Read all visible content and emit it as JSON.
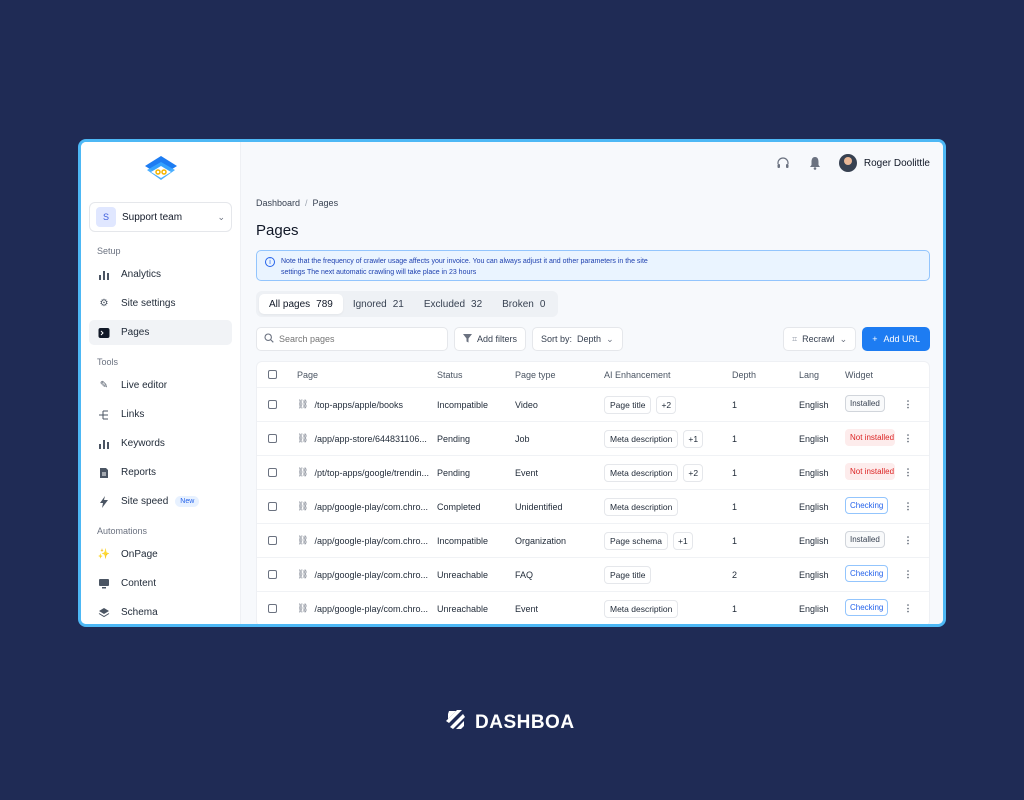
{
  "sidebar": {
    "team": {
      "initial": "S",
      "name": "Support team"
    },
    "sections": [
      {
        "label": "Setup",
        "items": [
          {
            "label": "Analytics",
            "icon": "bar-chart-icon"
          },
          {
            "label": "Site settings",
            "icon": "gear-icon"
          },
          {
            "label": "Pages",
            "icon": "terminal-icon",
            "active": true
          }
        ]
      },
      {
        "label": "Tools",
        "items": [
          {
            "label": "Live editor",
            "icon": "pen-icon"
          },
          {
            "label": "Links",
            "icon": "tree-icon"
          },
          {
            "label": "Keywords",
            "icon": "bar-chart-icon"
          },
          {
            "label": "Reports",
            "icon": "document-icon"
          },
          {
            "label": "Site speed",
            "icon": "bolt-icon",
            "badge": "New"
          }
        ]
      },
      {
        "label": "Automations",
        "items": [
          {
            "label": "OnPage",
            "icon": "wand-icon"
          },
          {
            "label": "Content",
            "icon": "monitor-icon"
          },
          {
            "label": "Schema",
            "icon": "layers-icon"
          }
        ]
      }
    ]
  },
  "header": {
    "user_name": "Roger Doolittle"
  },
  "breadcrumb": {
    "root": "Dashboard",
    "separator": "/",
    "current": "Pages"
  },
  "page_title": "Pages",
  "notice": {
    "text": "Note that the frequency of crawler usage affects your invoice. You can always adjust it and other parameters in the site settings The next automatic crawling will take place in 23 hours"
  },
  "tabs": [
    {
      "label": "All pages",
      "count": "789",
      "active": true
    },
    {
      "label": "Ignored",
      "count": "21"
    },
    {
      "label": "Excluded",
      "count": "32"
    },
    {
      "label": "Broken",
      "count": "0"
    }
  ],
  "toolbar": {
    "search_placeholder": "Search pages",
    "filters_label": "Add filters",
    "sort_label": "Sort by:",
    "sort_value": "Depth",
    "recrawl_label": "Recrawl",
    "add_url_label": "Add URL"
  },
  "table": {
    "columns": [
      "Page",
      "Status",
      "Page type",
      "AI Enhancement",
      "Depth",
      "Lang",
      "Widget"
    ],
    "rows": [
      {
        "page": "/top-apps/apple/books",
        "status": "Incompatible",
        "type": "Video",
        "ai": "Page title",
        "ai_more": "+2",
        "depth": "1",
        "lang": "English",
        "widget": "Installed",
        "widget_state": "installed"
      },
      {
        "page": "/app/app-store/644831106...",
        "status": "Pending",
        "type": "Job",
        "ai": "Meta description",
        "ai_more": "+1",
        "depth": "1",
        "lang": "English",
        "widget": "Not installed",
        "widget_state": "not"
      },
      {
        "page": "/pt/top-apps/google/trendin...",
        "status": "Pending",
        "type": "Event",
        "ai": "Meta description",
        "ai_more": "+2",
        "depth": "1",
        "lang": "English",
        "widget": "Not installed",
        "widget_state": "not"
      },
      {
        "page": "/app/google-play/com.chro...",
        "status": "Completed",
        "type": "Unidentified",
        "ai": "Meta description",
        "ai_more": "",
        "depth": "1",
        "lang": "English",
        "widget": "Checking",
        "widget_state": "checking"
      },
      {
        "page": "/app/google-play/com.chro...",
        "status": "Incompatible",
        "type": "Organization",
        "ai": "Page schema",
        "ai_more": "+1",
        "depth": "1",
        "lang": "English",
        "widget": "Installed",
        "widget_state": "installed"
      },
      {
        "page": "/app/google-play/com.chro...",
        "status": "Unreachable",
        "type": "FAQ",
        "ai": "Page title",
        "ai_more": "",
        "depth": "2",
        "lang": "English",
        "widget": "Checking",
        "widget_state": "checking"
      },
      {
        "page": "/app/google-play/com.chro...",
        "status": "Unreachable",
        "type": "Event",
        "ai": "Meta description",
        "ai_more": "",
        "depth": "1",
        "lang": "English",
        "widget": "Checking",
        "widget_state": "checking"
      }
    ]
  },
  "brand": {
    "name": "DASHBOA"
  },
  "colors": {
    "background": "#1f2b55",
    "accent": "#1d7cf2",
    "frame_border": "#4db8f5",
    "danger": "#dc2626"
  }
}
